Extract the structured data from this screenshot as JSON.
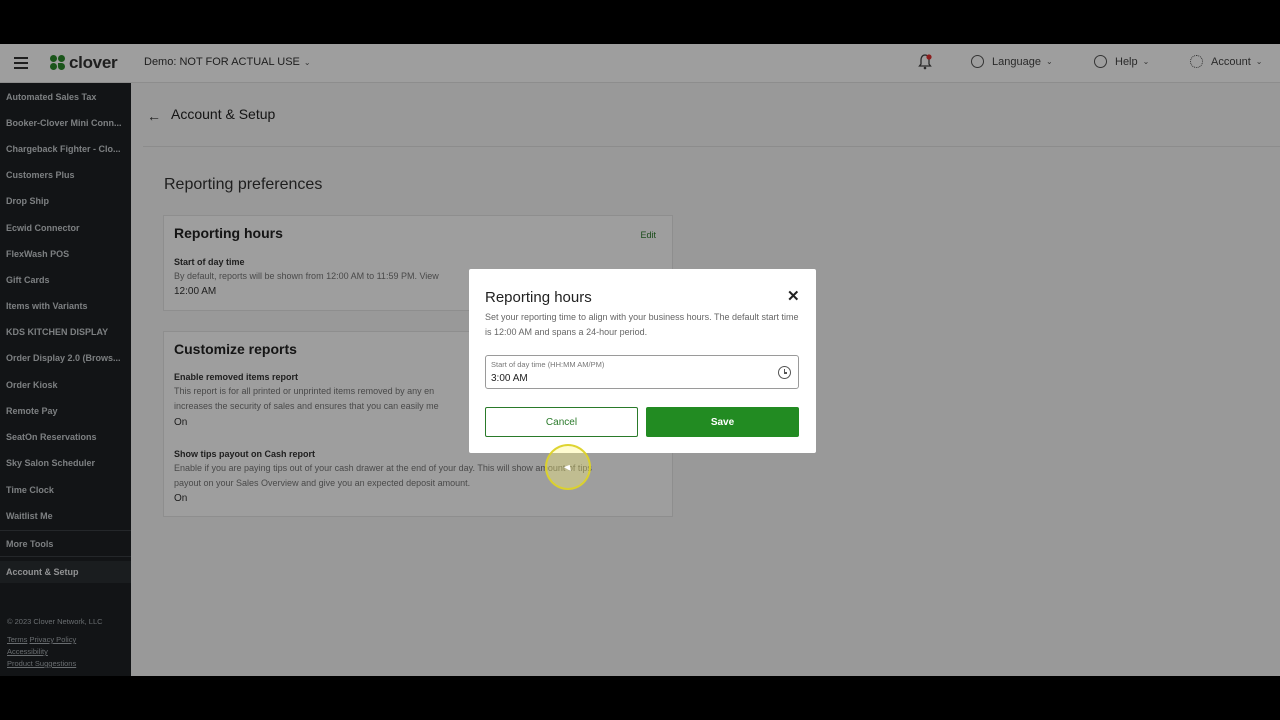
{
  "topbar": {
    "logo_text": "clover",
    "merchant": "Demo: NOT FOR ACTUAL USE",
    "language": "Language",
    "help": "Help",
    "account": "Account"
  },
  "sidebar": {
    "items": [
      "Automated Sales Tax",
      "Booker-Clover Mini Conn...",
      "Chargeback Fighter - Clo...",
      "Customers Plus",
      "Drop Ship",
      "Ecwid Connector",
      "FlexWash POS",
      "Gift Cards",
      "Items with Variants",
      "KDS KITCHEN DISPLAY",
      "Order Display 2.0 (Brows...",
      "Order Kiosk",
      "Remote Pay",
      "SeatOn Reservations",
      "Sky Salon Scheduler",
      "Time Clock",
      "Waitlist Me"
    ],
    "more_tools": "More Tools",
    "active": "Account & Setup",
    "copyright": "© 2023 Clover Network, LLC",
    "links": {
      "terms": "Terms",
      "privacy": "Privacy Policy",
      "accessibility": "Accessibility",
      "suggestions": "Product Suggestions"
    }
  },
  "main": {
    "page_title": "Account & Setup",
    "section_title": "Reporting preferences",
    "reporting_hours": {
      "title": "Reporting hours",
      "edit": "Edit",
      "label": "Start of day time",
      "desc": "By default, reports will be shown from 12:00 AM to 11:59 PM. View",
      "value": "12:00 AM"
    },
    "customize": {
      "title": "Customize reports",
      "removed_label": "Enable removed items report",
      "removed_desc_1": "This report is for all printed or unprinted items removed by any en",
      "removed_desc_2": "increases the security of sales and ensures that you can easily me",
      "removed_value": "On",
      "tips_label": "Show tips payout on Cash report",
      "tips_desc_1": "Enable if you are paying tips out of your cash drawer at the end of your day. This will show amount of tips",
      "tips_desc_2": "payout on your Sales Overview and give you an expected deposit amount.",
      "tips_value": "On"
    }
  },
  "modal": {
    "title": "Reporting hours",
    "close": "✕",
    "desc": "Set your reporting time to align with your business hours. The default start time is 12:00 AM and spans a 24-hour period.",
    "field_label": "Start of day time (HH:MM AM/PM)",
    "field_value": "3:00 AM",
    "cancel": "Cancel",
    "save": "Save"
  },
  "colors": {
    "brand_green": "#228b22",
    "sidebar_bg": "#1d2124"
  }
}
